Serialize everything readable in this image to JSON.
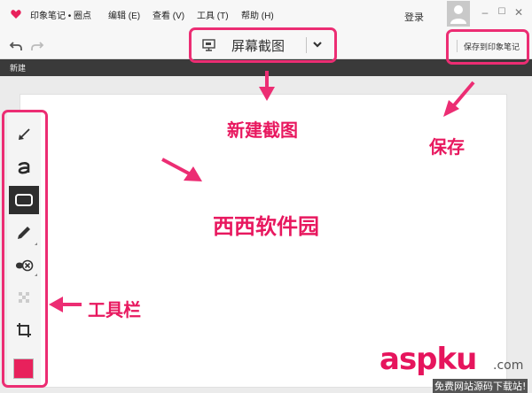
{
  "app": {
    "title": "印象笔记 • 圈点",
    "menu": [
      "编辑 (E)",
      "查看 (V)",
      "工具 (T)",
      "帮助 (H)"
    ],
    "login_label": "登录"
  },
  "window_controls": {
    "minimize": "–",
    "maximize": "☐",
    "close": "✕"
  },
  "toolbar": {
    "screenshot_label": "屏幕截图",
    "save_label": "保存到印象笔记"
  },
  "subbar": {
    "new_label": "新建"
  },
  "tools": [
    "arrow-icon",
    "text-icon",
    "rectangle-icon",
    "pen-icon",
    "stamp-icon",
    "pixelate-icon",
    "crop-icon"
  ],
  "colors": {
    "accent": "#ec2d73",
    "swatch": "#e8215c",
    "dark_bar": "#3a3a3a"
  },
  "annotations": {
    "new_screenshot": "新建截图",
    "save": "保存",
    "watermark_text": "西西软件园",
    "toolbar": "工具栏"
  },
  "watermark": {
    "main": "aspku",
    "domain": ".com",
    "tagline": "免费网站源码下载站!"
  }
}
